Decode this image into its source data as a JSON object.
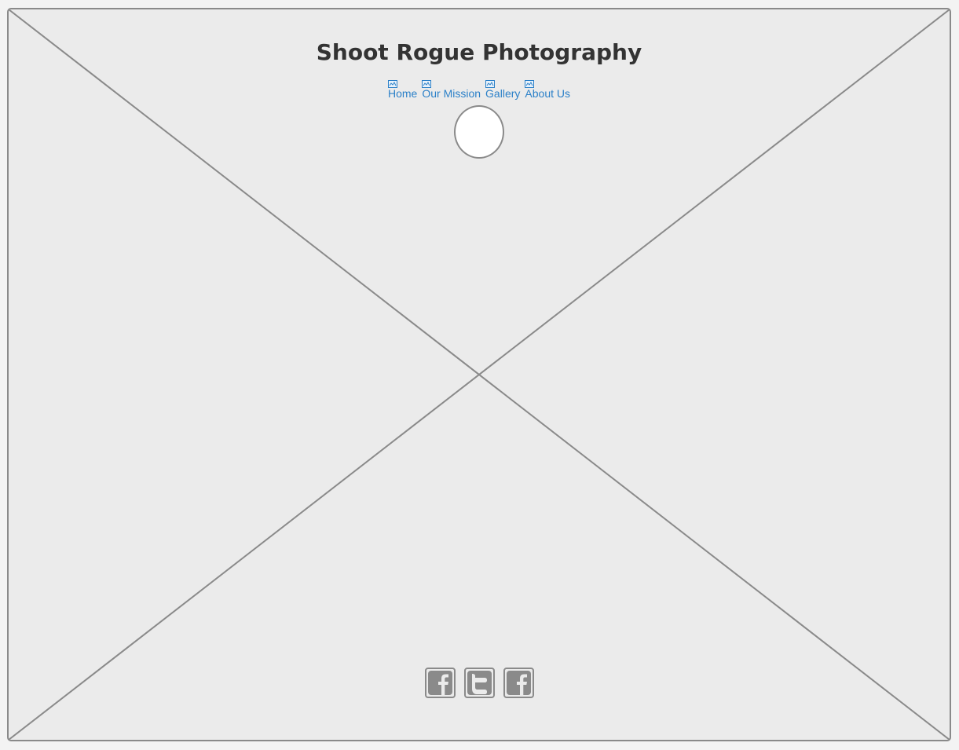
{
  "header": {
    "title": "Shoot Rogue Photography"
  },
  "nav": {
    "items": [
      {
        "label": "Home",
        "icon": "broken-image-icon"
      },
      {
        "label": "Our Mission",
        "icon": "broken-image-icon"
      },
      {
        "label": "Gallery",
        "icon": "broken-image-icon"
      },
      {
        "label": "About Us",
        "icon": "broken-image-icon"
      }
    ]
  },
  "logo": {
    "shape": "circle-placeholder"
  },
  "background": {
    "type": "image-placeholder"
  },
  "social": {
    "icons": [
      "facebook-icon",
      "twitter-icon",
      "facebook-icon"
    ]
  },
  "colors": {
    "page_background": "#f3f3f3",
    "canvas_background": "#ebebeb",
    "border": "#8a8a8a",
    "title_text": "#333333",
    "link": "#2b80c8",
    "icon_fill": "#8a8a8a"
  }
}
